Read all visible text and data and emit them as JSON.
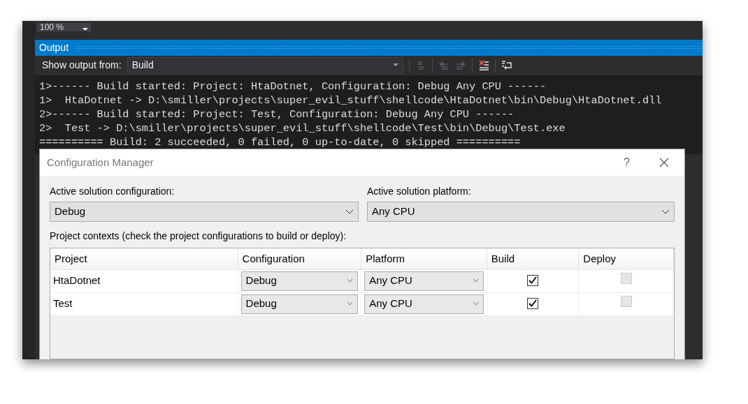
{
  "zoom_combo": {
    "value": "100 %"
  },
  "output_panel": {
    "title": "Output",
    "source": {
      "label": "Show output from:",
      "value": "Build"
    },
    "toolbar": [
      {
        "kind": "goto",
        "disabled": true
      },
      {
        "kind": "prev",
        "disabled": true
      },
      {
        "kind": "next",
        "disabled": true
      },
      {
        "kind": "clear",
        "disabled": false
      },
      {
        "kind": "wrap",
        "disabled": false
      }
    ],
    "lines": [
      "1>------ Build started: Project: HtaDotnet, Configuration: Debug Any CPU ------",
      "1>  HtaDotnet -> D:\\smiller\\projects\\super_evil_stuff\\shellcode\\HtaDotnet\\bin\\Debug\\HtaDotnet.dll",
      "2>------ Build started: Project: Test, Configuration: Debug Any CPU ------",
      "2>  Test -> D:\\smiller\\projects\\super_evil_stuff\\shellcode\\Test\\bin\\Debug\\Test.exe",
      "========== Build: 2 succeeded, 0 failed, 0 up-to-date, 0 skipped =========="
    ]
  },
  "dialog": {
    "title": "Configuration Manager",
    "help": "?",
    "active_configuration": {
      "label": "Active solution configuration:",
      "value": "Debug"
    },
    "active_platform": {
      "label": "Active solution platform:",
      "value": "Any CPU"
    },
    "contexts_label": "Project contexts (check the project configurations to build or deploy):",
    "table": {
      "columns": [
        "Project",
        "Configuration",
        "Platform",
        "Build",
        "Deploy"
      ],
      "rows": [
        {
          "project": "HtaDotnet",
          "configuration": "Debug",
          "platform": "Any CPU",
          "build": {
            "checked": true,
            "disabled": false
          },
          "deploy": {
            "checked": false,
            "disabled": true
          }
        },
        {
          "project": "Test",
          "configuration": "Debug",
          "platform": "Any CPU",
          "build": {
            "checked": true,
            "disabled": false
          },
          "deploy": {
            "checked": false,
            "disabled": true
          }
        }
      ]
    }
  }
}
